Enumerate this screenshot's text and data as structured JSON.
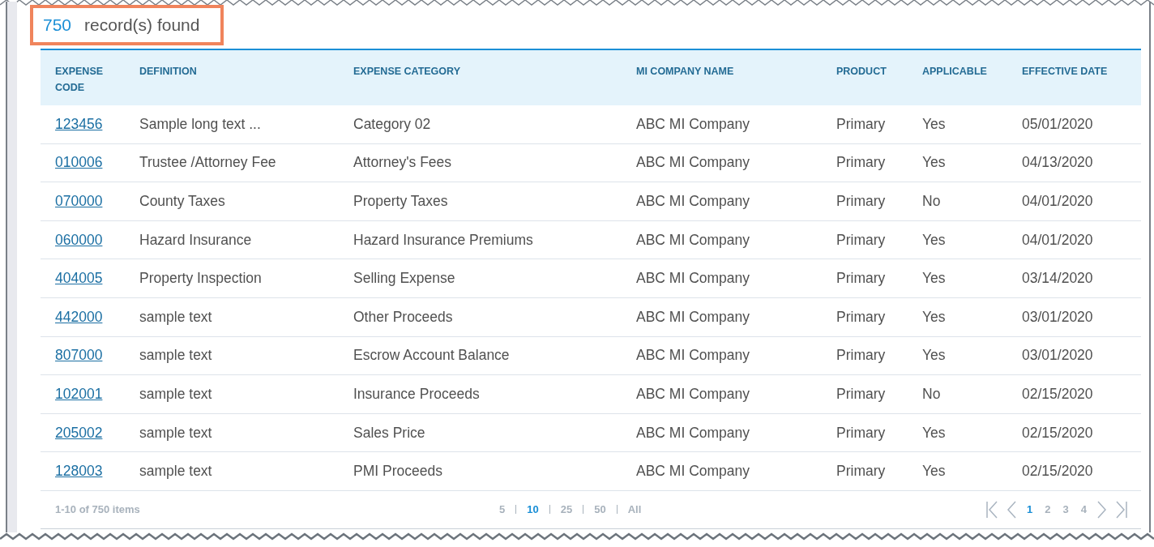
{
  "summary": {
    "count": "750",
    "label": "record(s) found"
  },
  "table": {
    "columns": [
      "EXPENSE CODE",
      "DEFINITION",
      "EXPENSE CATEGORY",
      "MI COMPANY NAME",
      "PRODUCT",
      "APPLICABLE",
      "EFFECTIVE DATE"
    ],
    "rows": [
      [
        "123456",
        "Sample long text ...",
        "Category 02",
        "ABC MI Company",
        "Primary",
        "Yes",
        "05/01/2020"
      ],
      [
        "010006",
        "Trustee /Attorney Fee",
        "Attorney's Fees",
        "ABC MI Company",
        "Primary",
        "Yes",
        "04/13/2020"
      ],
      [
        "070000",
        "County Taxes",
        "Property Taxes",
        "ABC MI Company",
        "Primary",
        "No",
        "04/01/2020"
      ],
      [
        "060000",
        "Hazard Insurance",
        "Hazard Insurance Premiums",
        "ABC MI Company",
        "Primary",
        "Yes",
        "04/01/2020"
      ],
      [
        "404005",
        "Property Inspection",
        "Selling Expense",
        "ABC MI Company",
        "Primary",
        "Yes",
        "03/14/2020"
      ],
      [
        "442000",
        "sample text",
        "Other Proceeds",
        "ABC MI Company",
        "Primary",
        "Yes",
        "03/01/2020"
      ],
      [
        "807000",
        "sample text",
        "Escrow Account Balance",
        "ABC MI Company",
        "Primary",
        "Yes",
        "03/01/2020"
      ],
      [
        "102001",
        "sample text",
        "Insurance Proceeds",
        "ABC MI Company",
        "Primary",
        "No",
        "02/15/2020"
      ],
      [
        "205002",
        "sample text",
        "Sales Price",
        "ABC MI Company",
        "Primary",
        "Yes",
        "02/15/2020"
      ],
      [
        "128003",
        "sample text",
        "PMI Proceeds",
        "ABC MI Company",
        "Primary",
        "Yes",
        "02/15/2020"
      ]
    ]
  },
  "pager": {
    "info": "1-10 of 750 items",
    "page_sizes": [
      {
        "label": "5",
        "selected": false
      },
      {
        "label": "10",
        "selected": true
      },
      {
        "label": "25",
        "selected": false
      },
      {
        "label": "50",
        "selected": false
      },
      {
        "label": "All",
        "selected": false
      }
    ],
    "pages": [
      {
        "label": "1",
        "selected": true
      },
      {
        "label": "2",
        "selected": false
      },
      {
        "label": "3",
        "selected": false
      },
      {
        "label": "4",
        "selected": false
      }
    ]
  }
}
